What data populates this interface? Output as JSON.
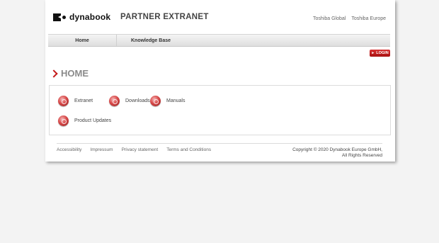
{
  "header": {
    "logo_text": "dynabook",
    "title": "PARTNER EXTRANET",
    "links": [
      "Toshiba Global",
      "Toshiba Europe"
    ]
  },
  "nav": {
    "items": [
      "Home",
      "Knowledge Base"
    ]
  },
  "login": {
    "label": "LOGIN"
  },
  "main": {
    "heading": "HOME",
    "tiles": [
      {
        "label": "Extranet",
        "icon": "red-sphere-icon"
      },
      {
        "label": "Downloads",
        "icon": "red-sphere-icon"
      },
      {
        "label": "Manuals",
        "icon": "red-sphere-icon"
      },
      {
        "label": "Product Updates",
        "icon": "red-sphere-icon"
      }
    ]
  },
  "footer": {
    "links": [
      "Accessibility",
      "Impressum",
      "Privacy statement",
      "Terms and Conditions"
    ],
    "copyright_line1": "Copyright © 2020 Dynabook Europe GmbH,",
    "copyright_line2": "All Rights Reserved"
  },
  "colors": {
    "accent": "#c41a1a",
    "background": "#f3f3f3",
    "heading": "#8a8a8a"
  }
}
